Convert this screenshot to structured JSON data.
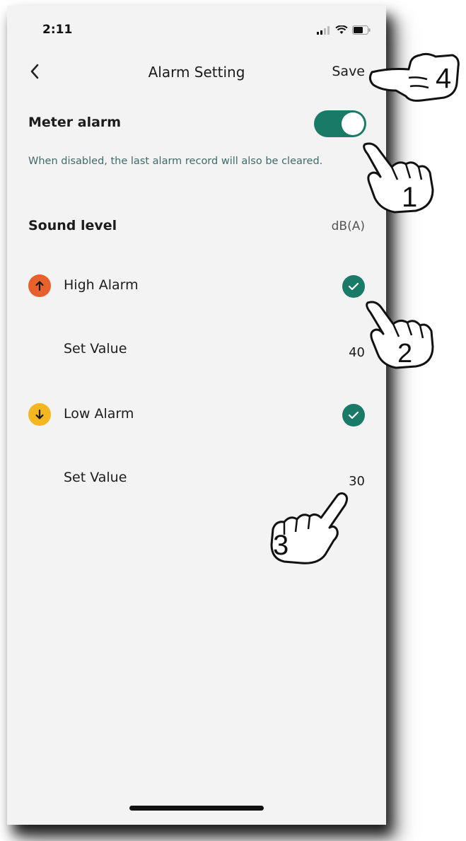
{
  "status": {
    "time": "2:11"
  },
  "nav": {
    "title": "Alarm Setting",
    "save_label": "Save"
  },
  "meter_alarm": {
    "label": "Meter alarm",
    "enabled": true,
    "hint": "When disabled, the last alarm record will also be cleared."
  },
  "sound_level": {
    "label": "Sound level",
    "unit": "dB(A)"
  },
  "high_alarm": {
    "label": "High Alarm",
    "checked": true,
    "icon": "arrow-up-icon",
    "color": "#e8612c",
    "set_value_label": "Set Value",
    "set_value": "40"
  },
  "low_alarm": {
    "label": "Low Alarm",
    "checked": true,
    "icon": "arrow-down-icon",
    "color": "#f5b71f",
    "set_value_label": "Set Value",
    "set_value": "30"
  },
  "callouts": [
    "1",
    "2",
    "3",
    "4"
  ],
  "colors": {
    "accent": "#1a7a68",
    "background": "#f3f3f3"
  }
}
